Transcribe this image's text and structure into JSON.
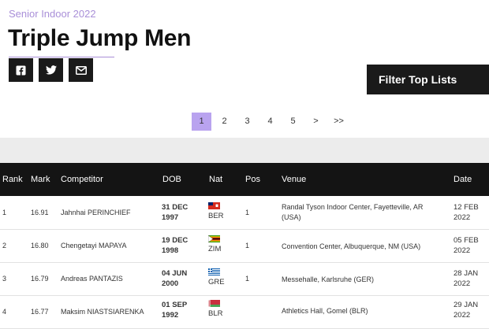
{
  "header": {
    "subtitle": "Senior Indoor 2022",
    "title": "Triple Jump Men"
  },
  "share": [
    {
      "icon": "facebook-icon"
    },
    {
      "icon": "twitter-icon"
    },
    {
      "icon": "email-icon"
    }
  ],
  "filter_label": "Filter Top Lists",
  "pagination": [
    "1",
    "2",
    "3",
    "4",
    "5",
    ">",
    ">>"
  ],
  "columns": [
    "Rank",
    "Mark",
    "Competitor",
    "DOB",
    "Nat",
    "Pos",
    "Venue",
    "Date"
  ],
  "rows": [
    {
      "rank": "1",
      "mark": "16.91",
      "competitor": "Jahnhai PERINCHIEF",
      "dob_line1": "31 DEC",
      "dob_line2": "1997",
      "nat": "BER",
      "pos": "1",
      "venue": "Randal Tyson Indoor Center, Fayetteville, AR (USA)",
      "date_line1": "12 FEB",
      "date_line2": "2022"
    },
    {
      "rank": "2",
      "mark": "16.80",
      "competitor": "Chengetayi MAPAYA",
      "dob_line1": "19 DEC",
      "dob_line2": "1998",
      "nat": "ZIM",
      "pos": "1",
      "venue": "Convention Center, Albuquerque, NM (USA)",
      "date_line1": "05 FEB",
      "date_line2": "2022"
    },
    {
      "rank": "3",
      "mark": "16.79",
      "competitor": "Andreas PANTAZIS",
      "dob_line1": "04 JUN",
      "dob_line2": "2000",
      "nat": "GRE",
      "pos": "1",
      "venue": "Messehalle, Karlsruhe (GER)",
      "date_line1": "28 JAN",
      "date_line2": "2022"
    },
    {
      "rank": "4",
      "mark": "16.77",
      "competitor": "Maksim NIASTSIARENKA",
      "dob_line1": "01 SEP",
      "dob_line2": "1992",
      "nat": "BLR",
      "pos": "",
      "venue": "Athletics Hall, Gomel (BLR)",
      "date_line1": "29 JAN",
      "date_line2": "2022"
    }
  ]
}
